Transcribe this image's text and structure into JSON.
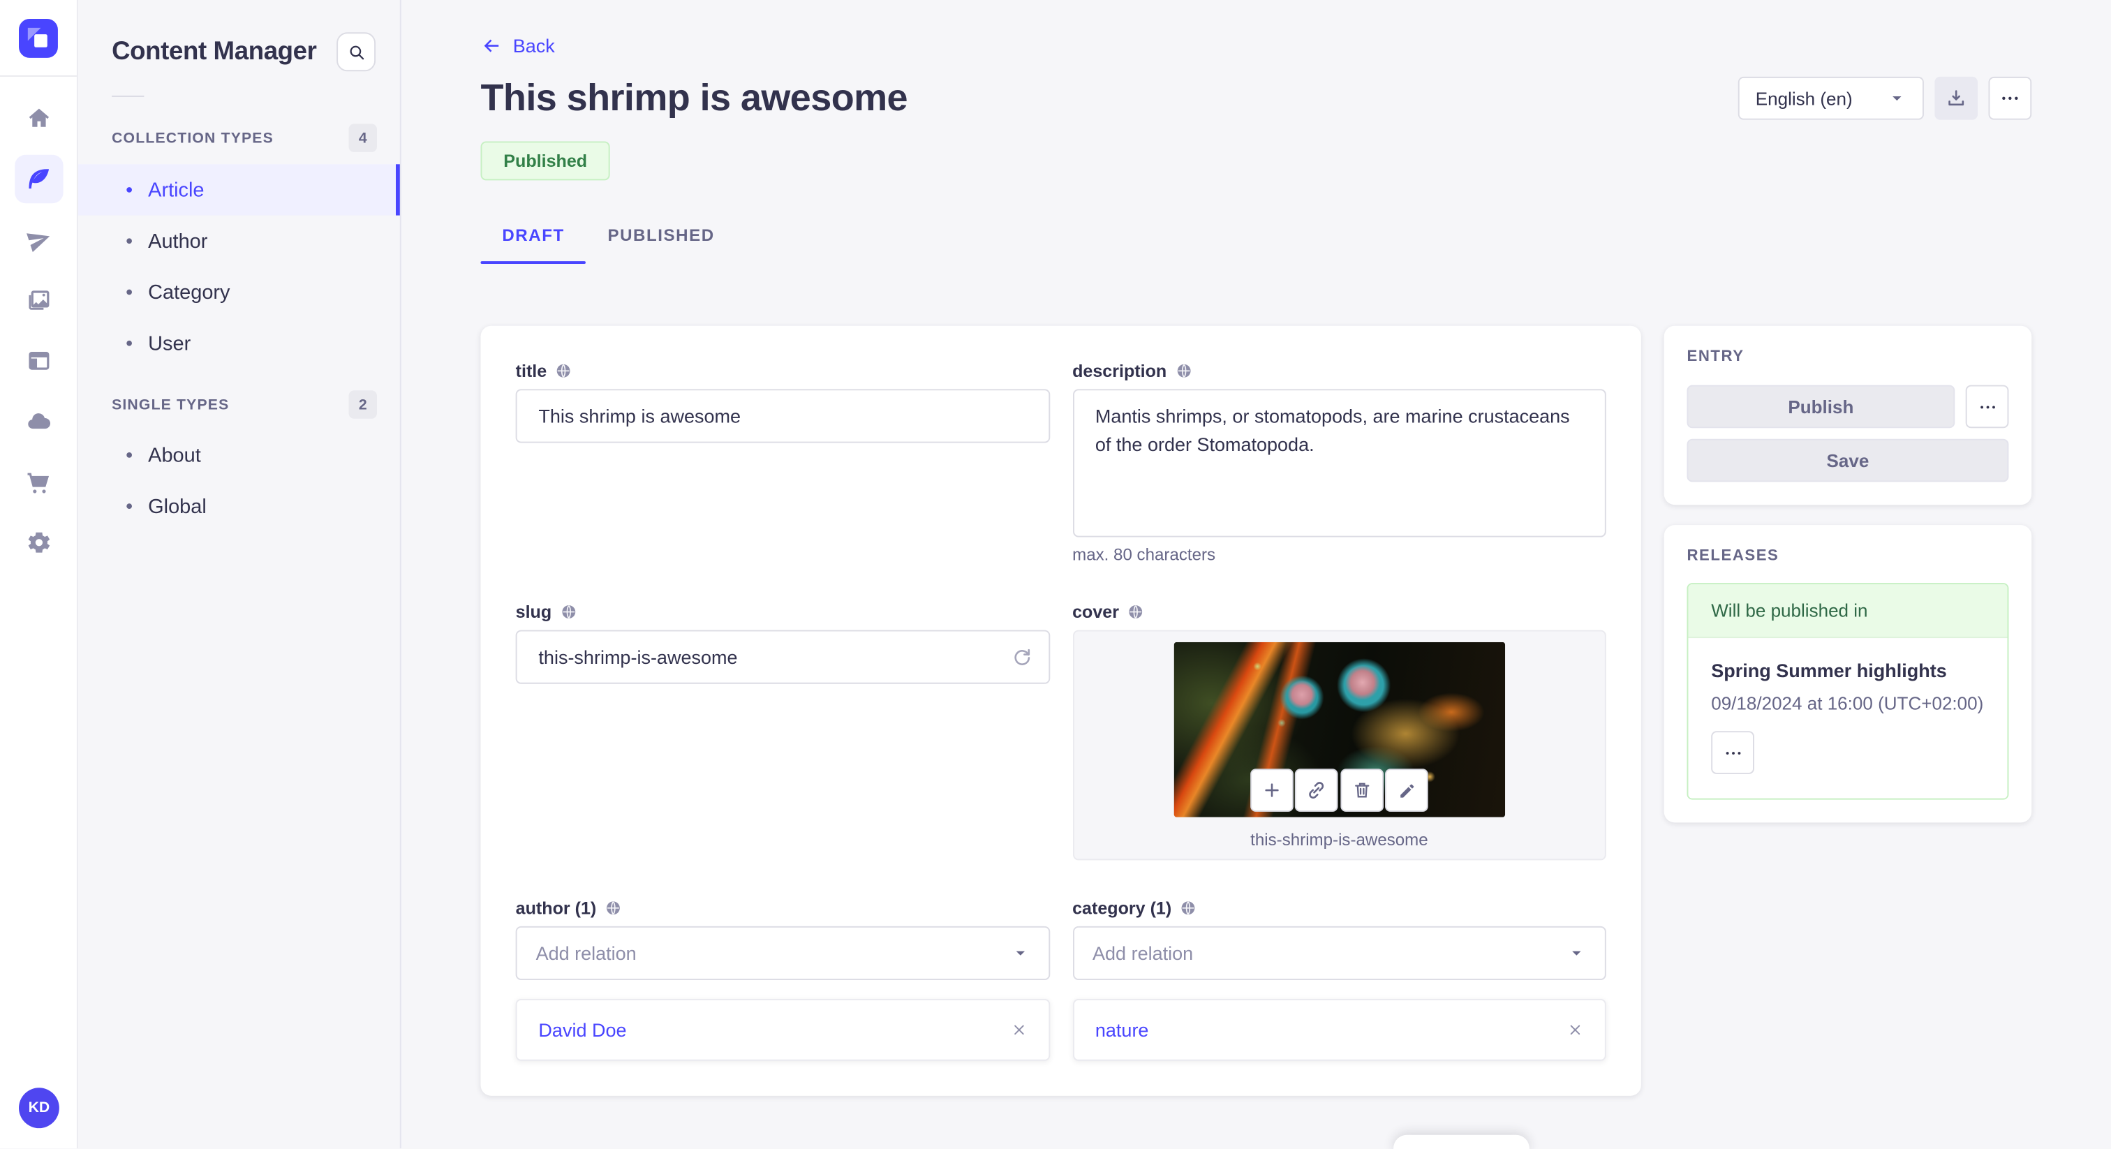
{
  "colors": {
    "accent": "#4945ff",
    "accent_bg": "#f0f0ff",
    "page_bg": "#f6f6f9",
    "border": "#dcdce4",
    "success_text": "#328048",
    "success_bg": "#eafbe7",
    "success_border": "#c6f0c2",
    "text_primary": "#32324d",
    "text_secondary": "#666687"
  },
  "nav": {
    "logo_icon": "strapi-logo",
    "icons": [
      "home-icon",
      "content-manager-feather-icon",
      "send-icon",
      "media-library-icon",
      "content-type-builder-icon",
      "cloud-icon",
      "marketplace-cart-icon",
      "settings-gear-icon"
    ],
    "avatar_initials": "KD"
  },
  "subnav": {
    "title": "Content Manager",
    "search_icon": "search-icon",
    "sections": [
      {
        "label": "COLLECTION TYPES",
        "count": "4",
        "items": [
          {
            "label": "Article"
          },
          {
            "label": "Author"
          },
          {
            "label": "Category"
          },
          {
            "label": "User"
          }
        ]
      },
      {
        "label": "SINGLE TYPES",
        "count": "2",
        "items": [
          {
            "label": "About"
          },
          {
            "label": "Global"
          }
        ]
      }
    ]
  },
  "header": {
    "back_label": "Back",
    "title": "This shrimp is awesome",
    "status": "Published",
    "locale": "English (en)",
    "tabs": [
      {
        "label": "DRAFT"
      },
      {
        "label": "PUBLISHED"
      }
    ]
  },
  "form": {
    "title": {
      "label": "title",
      "value": "This shrimp is awesome"
    },
    "description": {
      "label": "description",
      "value": "Mantis shrimps, or stomatopods, are marine crustaceans of the order Stomatopoda.",
      "hint": "max. 80 characters"
    },
    "slug": {
      "label": "slug",
      "value": "this-shrimp-is-awesome"
    },
    "cover": {
      "label": "cover",
      "caption": "this-shrimp-is-awesome"
    },
    "author": {
      "label": "author (1)",
      "placeholder": "Add relation",
      "relation": "David Doe"
    },
    "category": {
      "label": "category (1)",
      "placeholder": "Add relation",
      "relation": "nature"
    }
  },
  "entry_panel": {
    "title": "ENTRY",
    "publish_label": "Publish",
    "save_label": "Save"
  },
  "releases_panel": {
    "title": "RELEASES",
    "status": "Will be published in",
    "release_name": "Spring Summer highlights",
    "release_date": "09/18/2024 at 16:00 (UTC+02:00)"
  }
}
